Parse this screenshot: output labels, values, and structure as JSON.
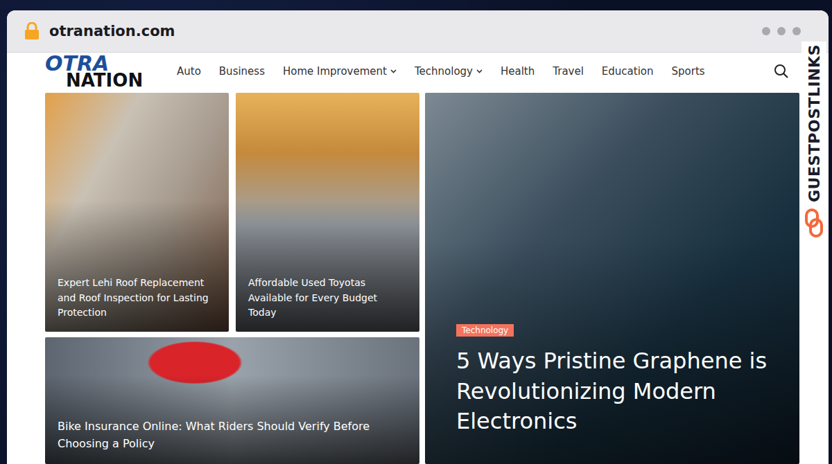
{
  "browser": {
    "url": "otranation.com"
  },
  "brand": {
    "top": "OTRA",
    "bottom": "NATION"
  },
  "watermark": {
    "text": "GUESTPOSTLINKS"
  },
  "nav": [
    {
      "label": "Auto",
      "dropdown": false
    },
    {
      "label": "Business",
      "dropdown": false
    },
    {
      "label": "Home Improvement",
      "dropdown": true
    },
    {
      "label": "Technology",
      "dropdown": true
    },
    {
      "label": "Health",
      "dropdown": false
    },
    {
      "label": "Travel",
      "dropdown": false
    },
    {
      "label": "Education",
      "dropdown": false
    },
    {
      "label": "Sports",
      "dropdown": false
    }
  ],
  "tiles": [
    {
      "title": "Expert Lehi Roof Replacement and Roof Inspection for Lasting Protection"
    },
    {
      "title": "Affordable Used Toyotas Available for Every Budget Today"
    }
  ],
  "wide": {
    "title": "Bike Insurance Online: What Riders Should Verify Before Choosing a Policy"
  },
  "featured": {
    "category": "Technology",
    "title": "5 Ways Pristine Graphene is Revolutionizing Modern Electronics"
  }
}
